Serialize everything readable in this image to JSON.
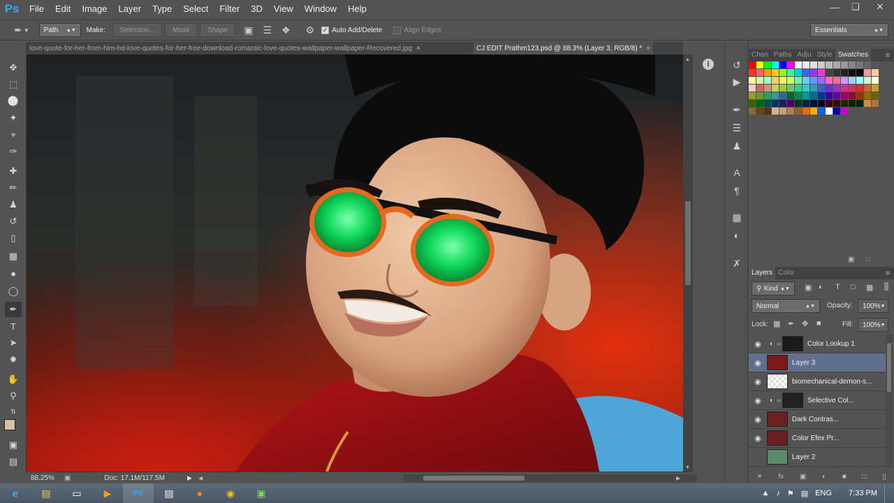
{
  "app": {
    "logo": "Ps"
  },
  "menu": [
    "File",
    "Edit",
    "Image",
    "Layer",
    "Type",
    "Select",
    "Filter",
    "3D",
    "View",
    "Window",
    "Help"
  ],
  "window_controls": [
    "minimize-icon",
    "restore-icon",
    "close-icon"
  ],
  "options": {
    "tool_mode": "Path",
    "make_label": "Make:",
    "selection_btn": "Selection...",
    "mask_btn": "Mask",
    "shape_btn": "Shape",
    "auto_add_delete": "Auto Add/Delete",
    "auto_add_delete_checked": true,
    "align_edges": "Align Edges",
    "align_edges_checked": false,
    "workspace": "Essentials"
  },
  "tabs": [
    {
      "label": "love-quote-for-her-from-him-hd-love-quotes-for-her-free-download-romantic-love-quotes-wallpaper-wallpaper-Recovered.jpg",
      "active": false
    },
    {
      "label": "CJ EDIT Prathm123.psd @ 88.3% (Layer 3, RGB/8) *",
      "active": true
    }
  ],
  "status": {
    "zoom": "88.25%",
    "doc": "Doc: 17.1M/117.5M"
  },
  "panels": {
    "top_tabs": [
      "Chan",
      "Paths",
      "Adju",
      "Style",
      "Swatches"
    ],
    "active_top_tab": "Swatches",
    "layer_tabs": [
      "Layers",
      "Color"
    ],
    "active_layer_tab": "Layers",
    "kind_filter": "Kind",
    "blend_mode": "Normal",
    "opacity_label": "Opacity:",
    "opacity": "100%",
    "lock_label": "Lock:",
    "fill_label": "Fill:",
    "fill": "100%"
  },
  "layers": [
    {
      "name": "Color Lookup 1",
      "visible": true,
      "adjustment": true,
      "thumb": "#1a1a1a",
      "selected": false
    },
    {
      "name": "Layer 3",
      "visible": true,
      "adjustment": false,
      "thumb": "#7a1a18",
      "selected": true
    },
    {
      "name": "biomechanical-demon-s...",
      "visible": true,
      "adjustment": false,
      "thumb": "checker",
      "selected": false
    },
    {
      "name": "Selective Col...",
      "visible": true,
      "adjustment": true,
      "thumb": "#222",
      "selected": false
    },
    {
      "name": "Dark Contras...",
      "visible": true,
      "adjustment": false,
      "thumb": "#6a2020",
      "selected": false
    },
    {
      "name": "Color Efex Pr...",
      "visible": true,
      "adjustment": false,
      "thumb": "#6a2020",
      "selected": false
    },
    {
      "name": "Layer 2",
      "visible": false,
      "adjustment": false,
      "thumb": "#5a8a6a",
      "selected": false
    }
  ],
  "swatch_colors": [
    "#ff0000",
    "#ffff00",
    "#00ff00",
    "#00ffff",
    "#0000ff",
    "#ff00ff",
    "#ffffff",
    "#eeeeee",
    "#dddddd",
    "#cccccc",
    "#bbbbbb",
    "#aaaaaa",
    "#999999",
    "#888888",
    "#777777",
    "#666666",
    "#555555",
    "#ff3333",
    "#ff6666",
    "#ff9900",
    "#ffcc00",
    "#99ff00",
    "#33ff99",
    "#00ccff",
    "#3366ff",
    "#9933ff",
    "#ff33cc",
    "#444444",
    "#333333",
    "#222222",
    "#111111",
    "#000000",
    "#ff9999",
    "#ffcc99",
    "#ffff99",
    "#ccff99",
    "#99ffcc",
    "#ffcc66",
    "#ffee66",
    "#ccff66",
    "#66ff99",
    "#66ccff",
    "#6699ff",
    "#9966ff",
    "#ff66cc",
    "#ff6699",
    "#cc99ff",
    "#99ccff",
    "#99ffff",
    "#ccffcc",
    "#ffffcc",
    "#ffcccc",
    "#cc6666",
    "#cc9966",
    "#cccc66",
    "#99cc33",
    "#66cc66",
    "#33cc99",
    "#33cccc",
    "#3399cc",
    "#3366cc",
    "#6633cc",
    "#9933cc",
    "#cc3399",
    "#cc3366",
    "#cc3333",
    "#cc6633",
    "#cc9933",
    "#999933",
    "#669933",
    "#339966",
    "#339999",
    "#336699",
    "#006633",
    "#008844",
    "#009999",
    "#006699",
    "#003399",
    "#330099",
    "#660099",
    "#990066",
    "#990033",
    "#993300",
    "#996600",
    "#666600",
    "#336600",
    "#006600",
    "#004d4d",
    "#003366",
    "#1a1a66",
    "#4d0066",
    "#003322",
    "#002244",
    "#001133",
    "#110033",
    "#330022",
    "#331100",
    "#222200",
    "#112200",
    "#002211",
    "#cc8844",
    "#aa7744",
    "#886633",
    "#664422",
    "#553311",
    "#d9b38c",
    "#c8a070",
    "#b08050",
    "#8c6239",
    "#ff6600",
    "#ffaa00",
    "#0066ff",
    "#ffffff",
    "#0000aa",
    "#cc00cc"
  ]
}
